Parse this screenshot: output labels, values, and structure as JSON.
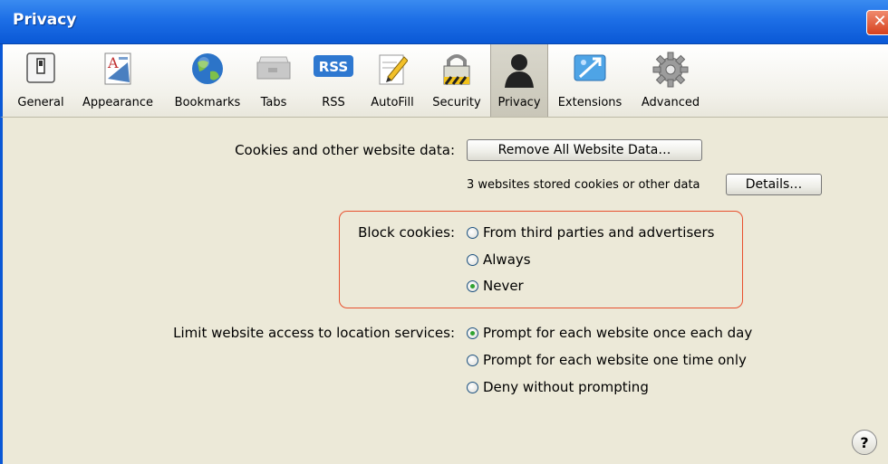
{
  "window": {
    "title": "Privacy",
    "close_glyph": "✕"
  },
  "toolbar": {
    "items": [
      {
        "label": "General",
        "icon": "switch-icon"
      },
      {
        "label": "Appearance",
        "icon": "font-icon"
      },
      {
        "label": "Bookmarks",
        "icon": "globe-icon"
      },
      {
        "label": "Tabs",
        "icon": "tabs-icon"
      },
      {
        "label": "RSS",
        "icon": "rss-icon"
      },
      {
        "label": "AutoFill",
        "icon": "pencil-icon"
      },
      {
        "label": "Security",
        "icon": "lock-icon"
      },
      {
        "label": "Privacy",
        "icon": "silhouette-icon"
      },
      {
        "label": "Extensions",
        "icon": "puzzle-icon"
      },
      {
        "label": "Advanced",
        "icon": "gear-icon"
      }
    ],
    "rss_badge": "RSS",
    "selected": "Privacy"
  },
  "cookies": {
    "label": "Cookies and other website data:",
    "remove_button": "Remove All Website Data…",
    "stored_text": "3 websites stored cookies or other data",
    "details_button": "Details…"
  },
  "block_cookies": {
    "label": "Block cookies:",
    "options": [
      {
        "label": "From third parties and advertisers",
        "checked": false
      },
      {
        "label": "Always",
        "checked": false
      },
      {
        "label": "Never",
        "checked": true
      }
    ]
  },
  "location": {
    "label": "Limit website access to location services:",
    "options": [
      {
        "label": "Prompt for each website once each day",
        "checked": true
      },
      {
        "label": "Prompt for each website one time only",
        "checked": false
      },
      {
        "label": "Deny without prompting",
        "checked": false
      }
    ]
  },
  "help": {
    "glyph": "?"
  },
  "colors": {
    "titlebar": "#0a58d6",
    "panel": "#ece9d8",
    "highlight": "#e8502e",
    "radio_dot": "#2fa22f"
  }
}
